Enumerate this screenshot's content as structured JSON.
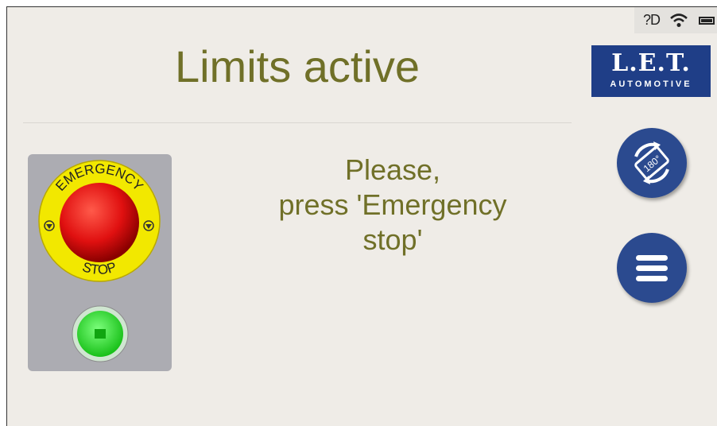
{
  "status_bar": {
    "indicator_text": "?D",
    "icons": [
      "wifi-icon",
      "battery-icon"
    ]
  },
  "header": {
    "title": "Limits active"
  },
  "logo": {
    "main": "L.E.T.",
    "sub": "AUTOMOTIVE"
  },
  "emergency_panel": {
    "ring_text_top": "EMERGENCY",
    "ring_text_bottom": "STOP"
  },
  "message": {
    "lines": [
      "Please,",
      "press 'Emergency",
      "stop'"
    ]
  },
  "buttons": {
    "rotate_label": "180°",
    "menu_icon": "hamburger-menu-icon"
  },
  "colors": {
    "background": "#efece7",
    "accent_text": "#707028",
    "brand_blue": "#1f3e87",
    "button_blue": "#2b4a8f"
  }
}
